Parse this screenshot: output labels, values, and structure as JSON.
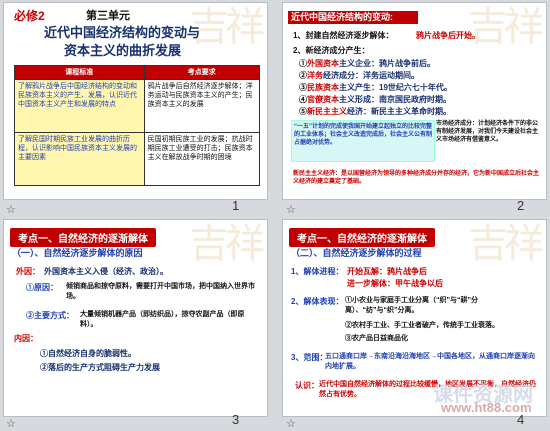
{
  "slides": [
    {
      "number": "1",
      "header_left": "必修2",
      "header_unit": "第三单元",
      "title_line1": "近代中国经济结构的变动与",
      "title_line2": "资本主义的曲折发展",
      "table": {
        "headers": [
          "课程标准",
          "考点要求"
        ],
        "row1": [
          "了解鸦片战争后中国经济结构的变动和民族资本主义的产生、发展，认识近代中国资本主义产生和发展的特点",
          "鸦片战争后自然经济逐步解体；洋务运动与民族资本主义的产生；民族资本主义的发展"
        ],
        "row2": [
          "了解民国时期民族工业发展的曲折历程，认识影响中国民族资本主义发展的主要因素",
          "民国初期民族工业的发展；抗战时期民族工业遭受的打击；民族资本主义在解放战争时期的困境"
        ]
      }
    },
    {
      "number": "2",
      "title": "近代中国经济结构的变动:",
      "line1_label": "1、封建自然经济逐步解体：",
      "line1_value": "鸦片战争后开始。",
      "line2": "2、新经济成分产生：",
      "items": [
        {
          "mark": "①",
          "hi": "外国资本",
          "rest": "主义企业：鸦片战争前后。"
        },
        {
          "mark": "②",
          "hi": "洋务",
          "rest": "经济成分：洋务运动期间。"
        },
        {
          "mark": "③",
          "hi": "民族资本",
          "rest": "主义产生：19世纪六七十年代。"
        },
        {
          "mark": "④",
          "hi": "官僚资本",
          "rest": "主义形成：南京国民政府时期。"
        },
        {
          "mark": "⑤",
          "hi": "新民主主义",
          "rest": "经济：新民主主义革命时期。"
        }
      ],
      "box_left": "“一五”计划的完成使我国开始建立起独立的比较完整的工业体系；社会主义改造完成后，社会主义公有制占据绝对优势。",
      "box_right": "市场经济成分：计划经济条件下的非公有制经济发展，对我们今天建设社会主义市场经济有借鉴意义。",
      "note": "新民主主义经济：是以国营经济为领导的多种经济成分并存的经济，它为新中国成立后社会主义经济的建立奠定了基础。"
    },
    {
      "number": "3",
      "pill": "考点一、自然经济的逐渐解体",
      "section": "（一）、自然经济逐步解体的原因",
      "cause_label": "外因：",
      "cause_text": "外国资本主义入侵（经济、政治）。",
      "sub1_mark": "①原因：",
      "sub1_text": "倾销商品和掠夺原料，需要打开中国市场，把中国纳入世界市场。",
      "sub2_mark": "②主要方式：",
      "sub2_text": "大量倾销机器产品（即纺织品），掠夺农副产品（即原料）。",
      "inner_label": "内因：",
      "inner_text1": "①自然经济自身的脆弱性。",
      "inner_text2": "②落后的生产方式阻碍生产力发展"
    },
    {
      "number": "4",
      "pill": "考点一、自然经济的逐渐解体",
      "section": "（二）、自然经济逐步解体的过程",
      "p1_label": "1、解体进程：",
      "p1_a": "开始瓦解：鸦片战争后",
      "p1_b": "进一步解体：甲午战争以后",
      "p2_label": "2、解体表现：",
      "p2_lines": [
        "①小农业与家庭手工业分离（“织”与“耕”分离）、“纺”与“织”分离。",
        "②农村手工业、手工业者破产，传统手工业衰落。",
        "③农产品日益商品化"
      ],
      "p3_label": "3、范围：",
      "p3_text": "五口通商口岸→东南沿海沿海地区→中国各地区，从通商口岸逐渐向内地扩展。",
      "conclusion_label": "认识：",
      "conclusion_text": "近代中国自然经济解体的过程比较缓慢，地区发展不平衡，自然经济仍然占有优势。",
      "watermark_big": "课件资源网",
      "watermark_url": "www.ht88.com"
    }
  ],
  "bottom_icon": "slide-star-icon"
}
